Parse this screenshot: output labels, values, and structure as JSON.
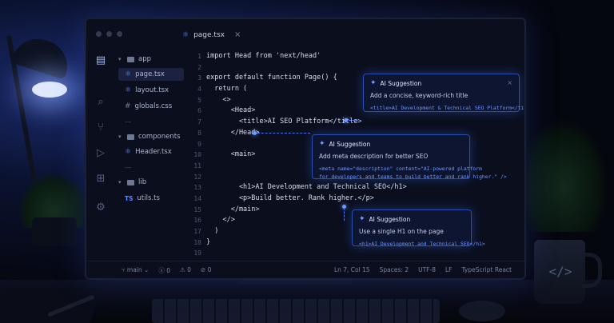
{
  "window": {
    "tab_name": "page.tsx",
    "tab_close": "×"
  },
  "explorer": {
    "items": [
      {
        "label": "app",
        "kind": "folder"
      },
      {
        "label": "page.tsx",
        "kind": "react"
      },
      {
        "label": "layout.tsx",
        "kind": "react"
      },
      {
        "label": "globals.css",
        "kind": "css"
      },
      {
        "label": "—",
        "kind": "sep"
      },
      {
        "label": "components",
        "kind": "folder"
      },
      {
        "label": "Header.tsx",
        "kind": "react"
      },
      {
        "label": "—",
        "kind": "sep"
      },
      {
        "label": "lib",
        "kind": "folder"
      },
      {
        "label": "utils.ts",
        "kind": "ts"
      }
    ],
    "ts_badge": "TS"
  },
  "editor": {
    "line_numbers": [
      "1",
      "2",
      "3",
      "4",
      "5",
      "6",
      "7",
      "8",
      "9",
      "10",
      "11",
      "12",
      "13",
      "14",
      "15",
      "16",
      "17",
      "18",
      "19"
    ],
    "lines": [
      "import Head from 'next/head'",
      "",
      "export default function Page() {",
      "  return (",
      "    <>",
      "      <Head>",
      "        <title>AI SEO Platform</title>",
      "      </Head>",
      "",
      "      <main>",
      "",
      "",
      "        <h1>AI Development and Technical SEO</h1>",
      "        <p>Build better. Rank higher.</p>",
      "      </main>",
      "    </>",
      "  )",
      "}",
      ""
    ]
  },
  "suggestions": [
    {
      "header": "AI Suggestion",
      "description": "Add a concise, keyword-rich title",
      "code": "<title>AI Development & Technical SEO Platform</title>",
      "close": "×"
    },
    {
      "header": "AI Suggestion",
      "description": "Add meta description for better SEO",
      "code": "<meta name=\"description\" content=\"AI-powered platform\nfor developers and teams to build better and rank higher.\" />"
    },
    {
      "header": "AI Suggestion",
      "description": "Use a single H1 on the page",
      "code": "<h1>AI Development and Technical SEO</h1>"
    }
  ],
  "statusbar": {
    "branch": "main",
    "errors": "0",
    "warnings": "0",
    "info": "0",
    "position": "Ln 7, Col 15",
    "spaces": "Spaces: 2",
    "encoding": "UTF-8",
    "eol": "LF",
    "language": "TypeScript React"
  },
  "mug_symbol": "</>",
  "colors": {
    "accent": "#4b73ff",
    "code_suggestion": "#6e96ff",
    "background": "#0b0f1d"
  }
}
